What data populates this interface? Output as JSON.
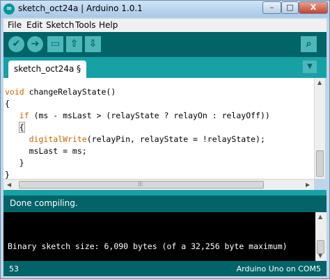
{
  "window": {
    "title": "sketch_oct24a | Arduino 1.0.1",
    "app_icon": "arduino-logo-icon",
    "controls": {
      "minimize": "–",
      "maximize": "□",
      "close": "X"
    }
  },
  "menu": [
    "File",
    "Edit",
    "Sketch",
    "Tools",
    "Help"
  ],
  "toolbar": {
    "buttons": [
      {
        "name": "verify",
        "icon": "checkmark-icon",
        "glyph": "✔"
      },
      {
        "name": "upload",
        "icon": "right-arrow-icon",
        "glyph": "➔"
      },
      {
        "name": "new",
        "icon": "new-file-icon",
        "glyph": "▭"
      },
      {
        "name": "open",
        "icon": "open-arrow-up-icon",
        "glyph": "⇧"
      },
      {
        "name": "save",
        "icon": "save-arrow-down-icon",
        "glyph": "⇩"
      }
    ],
    "serial_monitor_glyph": "⌕"
  },
  "tabs": {
    "active_label": "sketch_oct24a §",
    "menu_glyph": "▼"
  },
  "editor": {
    "lines": [
      "void changeRelayState()",
      "{",
      "   if (ms - msLast > (relayState ? relayOn : relayOff))",
      "   {",
      "     digitalWrite(relayPin, relayState = !relayState);",
      "     msLast = ms;",
      "   }",
      "}"
    ]
  },
  "status": {
    "message": "Done compiling."
  },
  "console": {
    "output": "Binary sketch size: 6,090 bytes (of a 32,256 byte maximum)"
  },
  "footer": {
    "line_number": "53",
    "board": "Arduino Uno on COM5"
  },
  "colors": {
    "toolbar": "#006468",
    "tabstrip": "#17a1a5",
    "button": "#4db7bb",
    "keyword": "#cc6600"
  }
}
